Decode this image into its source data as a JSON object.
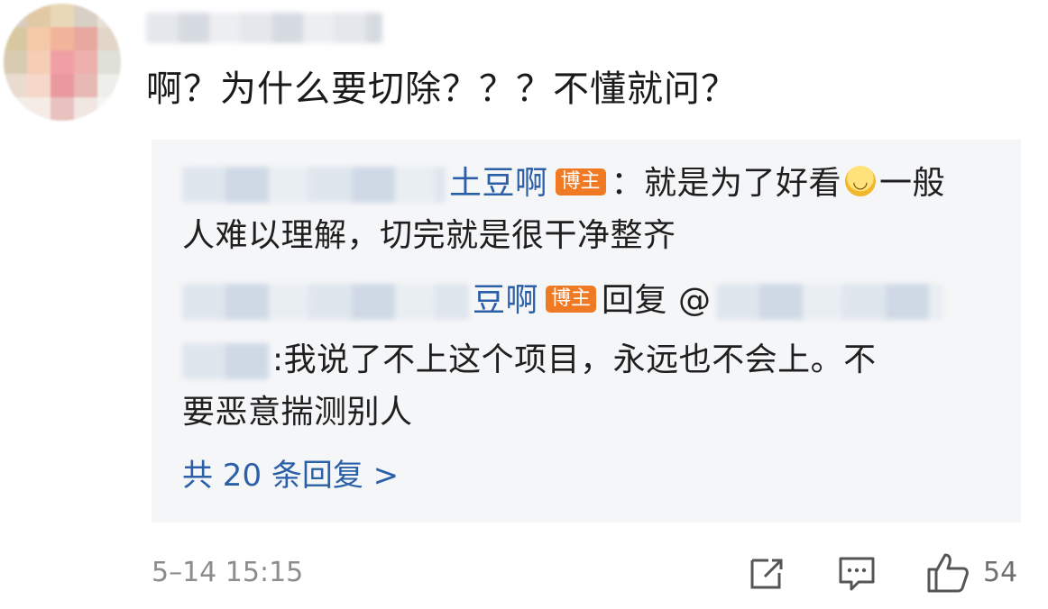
{
  "comment": {
    "text": "啊？为什么要切除？？？不懂就问？"
  },
  "reply_box": {
    "reply1": {
      "author": "土豆啊",
      "badge": "博主",
      "text_part1": "：就是为了好看",
      "text_part2": "一般",
      "line2": "人难以理解，切完就是很干净整齐"
    },
    "reply2": {
      "author": "豆啊",
      "badge": "博主",
      "reply_label": "回复 @",
      "line2_text": ":我说了不上这个项目，永远也不会上。不",
      "line3": "要恶意揣测别人"
    },
    "more_label": "共 20 条回复 >"
  },
  "footer": {
    "timestamp": "5–14 15:15",
    "like_count": "54"
  },
  "icons": {
    "share": "share-icon",
    "comment": "comment-icon",
    "like": "thumbs-up-icon",
    "emoji": "laugh-cry-emoji-icon"
  },
  "colors": {
    "link": "#2b60a8",
    "badge": "#f07a24",
    "reply_bg": "#f5f6f8",
    "meta": "#8c8c8c"
  }
}
